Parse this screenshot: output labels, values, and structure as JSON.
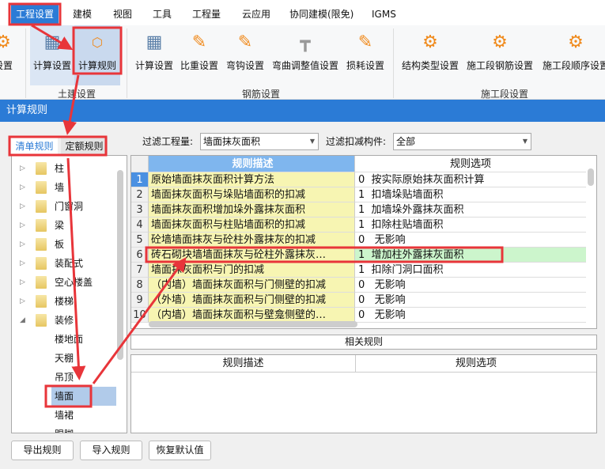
{
  "menu": {
    "tabs": [
      "工程设置",
      "建模",
      "视图",
      "工具",
      "工程量",
      "云应用",
      "协同建模(限免)",
      "IGMS"
    ],
    "active": 0
  },
  "ribbon": {
    "partial_label": "设置",
    "groups": [
      {
        "label": "土建设置",
        "buttons": [
          "计算设置",
          "计算规则"
        ]
      },
      {
        "label": "钢筋设置",
        "buttons": [
          "计算设置",
          "比重设置",
          "弯钩设置",
          "弯曲调整值设置",
          "损耗设置"
        ]
      },
      {
        "label": "施工段设置",
        "buttons": [
          "结构类型设置",
          "施工段钢筋设置",
          "施工段顺序设置"
        ]
      }
    ]
  },
  "dialog": {
    "title": "计算规则",
    "tabs": [
      "清单规则",
      "定额规则"
    ],
    "filter_quantity_label": "过滤工程量:",
    "filter_quantity_value": "墙面抹灰面积",
    "filter_component_label": "过滤扣减构件:",
    "filter_component_value": "全部",
    "tree": {
      "folders": [
        "柱",
        "墙",
        "门窗洞",
        "梁",
        "板",
        "装配式",
        "空心楼盖",
        "楼梯",
        "装修"
      ],
      "children": [
        "楼地面",
        "天棚",
        "吊顶",
        "墙面",
        "墙裙",
        "踢脚"
      ],
      "selected": "墙面"
    },
    "grid": {
      "headers": [
        "规则描述",
        "规则选项"
      ],
      "rows": [
        {
          "n": "1",
          "desc": "原始墙面抹灰面积计算方法",
          "opt": "0  按实际原始抹灰面积计算"
        },
        {
          "n": "2",
          "desc": "墙面抹灰面积与垛贴墙面积的扣减",
          "opt": "1  扣墙垛贴墙面积"
        },
        {
          "n": "3",
          "desc": "墙面抹灰面积增加垛外露抹灰面积",
          "opt": "1  加墙垛外露抹灰面积"
        },
        {
          "n": "4",
          "desc": "墙面抹灰面积与柱贴墙面积的扣减",
          "opt": "1  扣除柱贴墙面积"
        },
        {
          "n": "5",
          "desc": "砼墙墙面抹灰与砼柱外露抹灰的扣减",
          "opt": "0   无影响"
        },
        {
          "n": "6",
          "desc": "砖石砌块墙墙面抹灰与砼柱外露抹灰…",
          "opt": "1  增加柱外露抹灰面积"
        },
        {
          "n": "7",
          "desc": "墙面抹灰面积与门的扣减",
          "opt": "1  扣除门洞口面积"
        },
        {
          "n": "8",
          "desc": "（内墙）墙面抹灰面积与门侧壁的扣减",
          "opt": "0   无影响"
        },
        {
          "n": "9",
          "desc": "（外墙）墙面抹灰面积与门侧壁的扣减",
          "opt": "0   无影响"
        },
        {
          "n": "10",
          "desc": "（内墙）墙面抹灰面积与壁龛侧壁的…",
          "opt": "0   无影响"
        }
      ],
      "selected_row": 1,
      "highlighted_row": 6
    },
    "related_label": "相关规则",
    "related_headers": [
      "规则描述",
      "规则选项"
    ],
    "buttons": [
      "导出规则",
      "导入规则",
      "恢复默认值"
    ]
  },
  "colors": {
    "accent": "#2b7bd6",
    "annotation": "#e8353a",
    "desc_cell": "#f7f5b2",
    "highlight_row": "#ccf5cc",
    "header_cell": "#7fb6ee"
  }
}
